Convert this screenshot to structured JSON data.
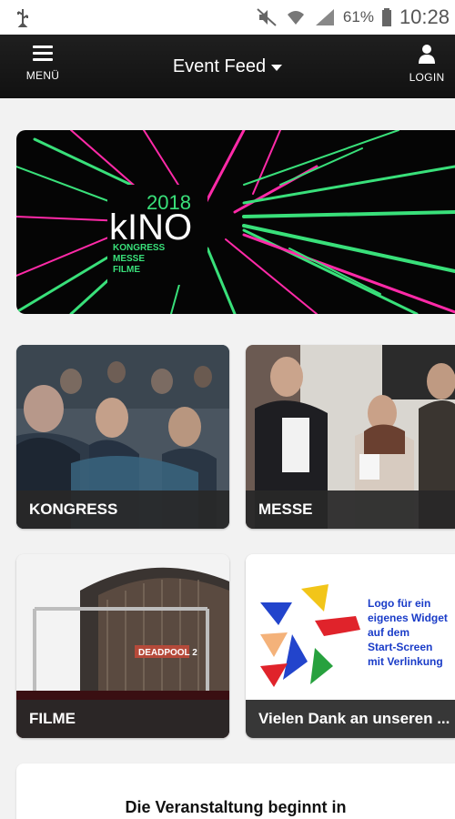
{
  "status_bar": {
    "battery_percent": "61%",
    "time": "10:28",
    "icons": [
      "usb-icon",
      "mute-icon",
      "wifi-icon",
      "signal-icon",
      "battery-icon"
    ]
  },
  "app_bar": {
    "menu_label": "MENÜ",
    "title": "Event Feed",
    "login_label": "LOGIN"
  },
  "banner": {
    "year": "2018",
    "brand": "kINO",
    "taglines": [
      "KONGRESS",
      "MESSE",
      "FILME"
    ],
    "colors": {
      "accent_green": "#39e07a",
      "accent_pink": "#ff2aa8",
      "background": "#050505"
    }
  },
  "tiles": [
    {
      "label": "KONGRESS",
      "image": "conference-audience"
    },
    {
      "label": "MESSE",
      "image": "trade-fair-people"
    },
    {
      "label": "FILME",
      "image": "cinema-building"
    },
    {
      "label": "Vielen Dank an unseren ...",
      "image": "tangram-logo",
      "logo_text": [
        "Logo für ein",
        "eigenes Widget",
        "auf dem",
        "Start-Screen",
        "mit Verlinkung"
      ]
    }
  ],
  "countdown": {
    "title": "Die Veranstaltung beginnt in"
  }
}
